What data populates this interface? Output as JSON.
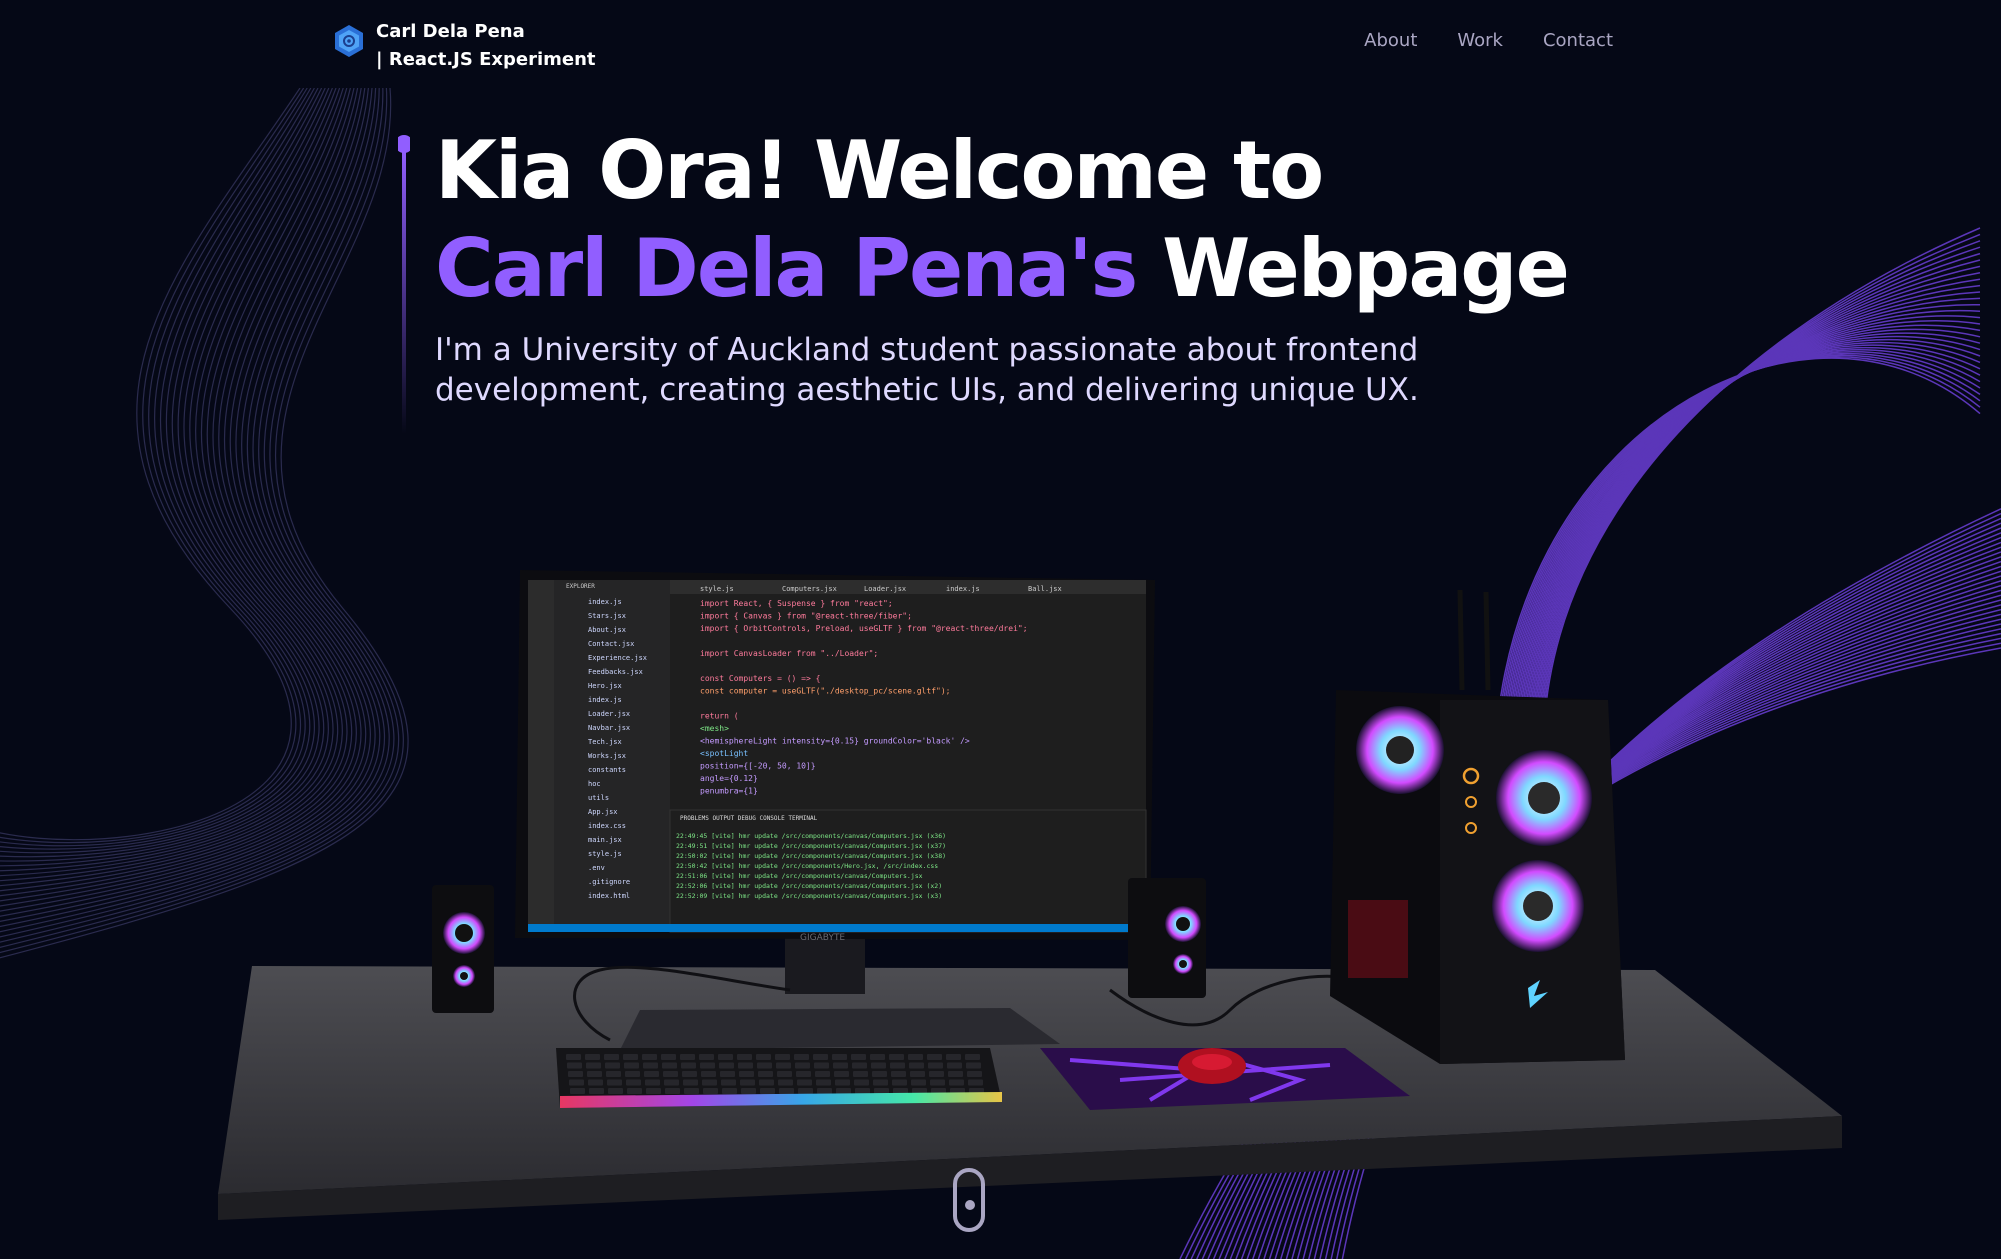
{
  "nav": {
    "brand_line1": "Carl Dela Pena",
    "brand_line2": "| React.JS Experiment",
    "links": [
      "About",
      "Work",
      "Contact"
    ]
  },
  "hero": {
    "title_line1": "Kia Ora! Welcome to",
    "title_name": "Carl Dela Pena's",
    "title_rest": "Webpage",
    "subtitle": "I'm a University of Auckland student passionate about frontend development, creating aesthetic UIs, and delivering unique UX."
  },
  "monitor": {
    "brand": "GIGABYTE",
    "editor_tabs": [
      "style.js",
      "Computers.jsx",
      "Loader.jsx",
      "index.js",
      "Ball.jsx"
    ],
    "code_lines": [
      "import React, { Suspense } from \"react\";",
      "import { Canvas } from \"@react-three/fiber\";",
      "import { OrbitControls, Preload, useGLTF } from \"@react-three/drei\";",
      "",
      "import CanvasLoader from \"../Loader\";",
      "",
      "const Computers = () => {",
      "  const computer = useGLTF(\"./desktop_pc/scene.gltf\");",
      "",
      "  return (",
      "    <mesh>",
      "      <hemisphereLight intensity={0.15} groundColor='black' />",
      "      <spotLight",
      "        position={[-20, 50, 10]}",
      "        angle={0.12}",
      "        penumbra={1}"
    ],
    "terminal_lines": [
      "22:49:45 [vite] hmr update /src/components/canvas/Computers.jsx (x36)",
      "22:49:51 [vite] hmr update /src/components/canvas/Computers.jsx (x37)",
      "22:50:02 [vite] hmr update /src/components/canvas/Computers.jsx (x38)",
      "22:50:42 [vite] hmr update /src/components/Hero.jsx, /src/index.css",
      "22:51:06 [vite] hmr update /src/components/canvas/Computers.jsx",
      "22:52:06 [vite] hmr update /src/components/canvas/Computers.jsx (x2)",
      "22:52:09 [vite] hmr update /src/components/canvas/Computers.jsx (x3)"
    ],
    "explorer_files": [
      "index.js",
      "Stars.jsx",
      "About.jsx",
      "Contact.jsx",
      "Experience.jsx",
      "Feedbacks.jsx",
      "Hero.jsx",
      "index.js",
      "Loader.jsx",
      "Navbar.jsx",
      "Tech.jsx",
      "Works.jsx",
      "constants",
      "hoc",
      "utils",
      "App.jsx",
      "index.css",
      "main.jsx",
      "style.js",
      ".env",
      ".gitignore",
      "index.html"
    ]
  },
  "colors": {
    "background": "#050816",
    "accent": "#915eff",
    "nav_link": "#aaa6c3",
    "subtitle": "#dfd9ff"
  },
  "icons": {
    "logo": "hexagon-logo-icon",
    "scroll": "mouse-scroll-icon"
  }
}
